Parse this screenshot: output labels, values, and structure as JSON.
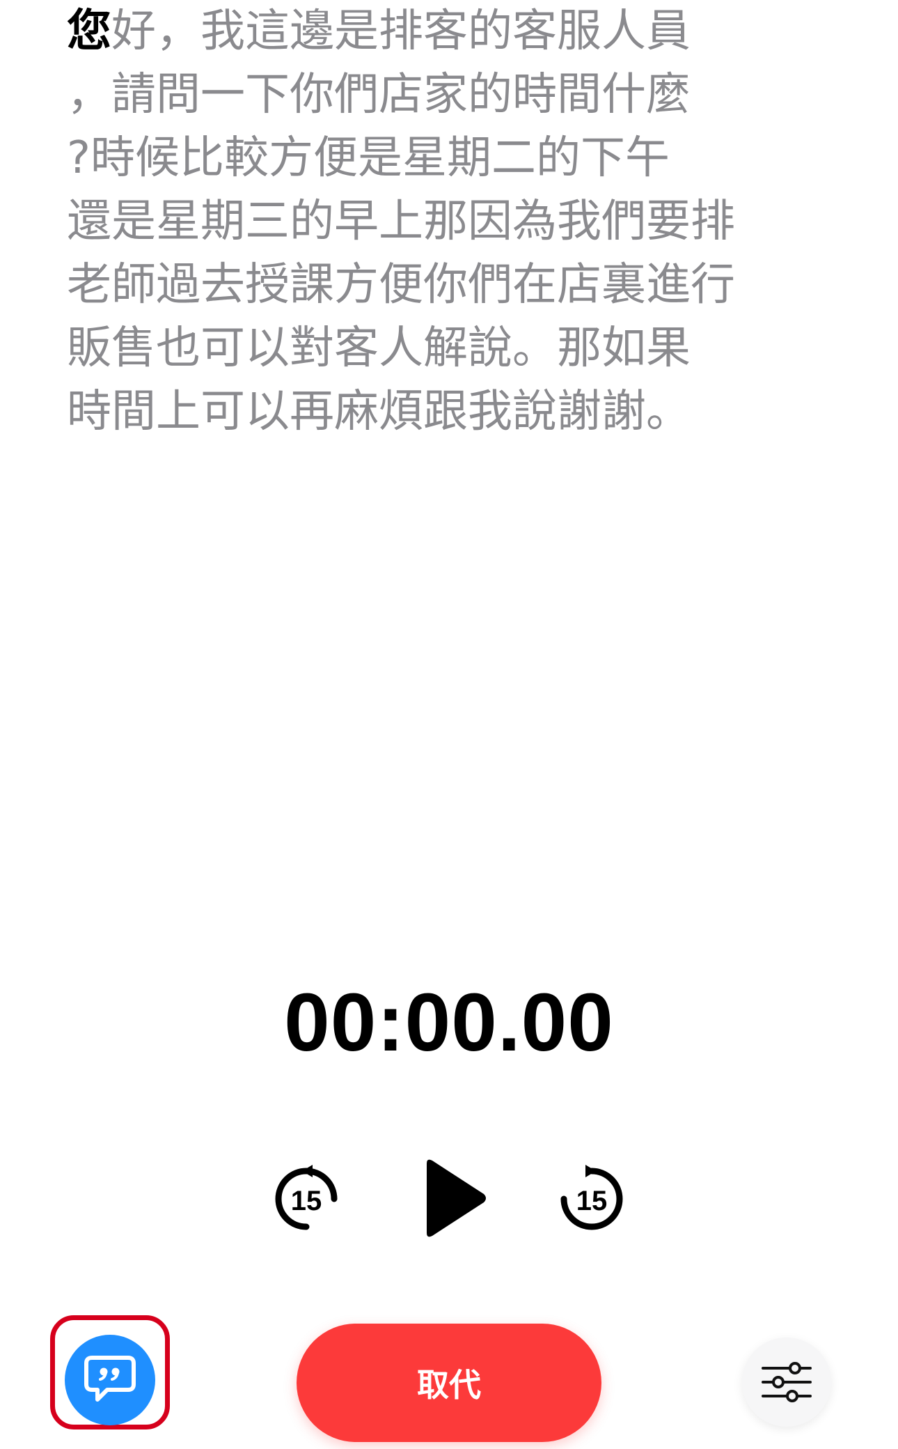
{
  "transcript": {
    "highlighted_word": "您",
    "lines": [
      "好，我這邊是排客的客服人員",
      "，請問一下你們店家的時間什麼",
      "?時候比較方便是星期二的下午",
      "還是星期三的早上那因為我們要排",
      "老師過去授課方便你們在店裏進行",
      "販售也可以對客人解說。那如果",
      "時間上可以再麻煩跟我說謝謝。"
    ]
  },
  "player": {
    "time": "00:00.00",
    "skip_back_seconds": "15",
    "skip_forward_seconds": "15",
    "icons": {
      "skip_back": "skip-back-15-icon",
      "play": "play-icon",
      "skip_forward": "skip-forward-15-icon"
    }
  },
  "bottom_bar": {
    "transcript_icon": "transcript-quote-bubble-icon",
    "replace_label": "取代",
    "settings_icon": "sliders-icon"
  },
  "colors": {
    "accent_blue": "#1f8fff",
    "replace_red": "#fc3a3a",
    "highlight_frame": "#d6001c",
    "transcript_gray": "#8a8a8e"
  }
}
